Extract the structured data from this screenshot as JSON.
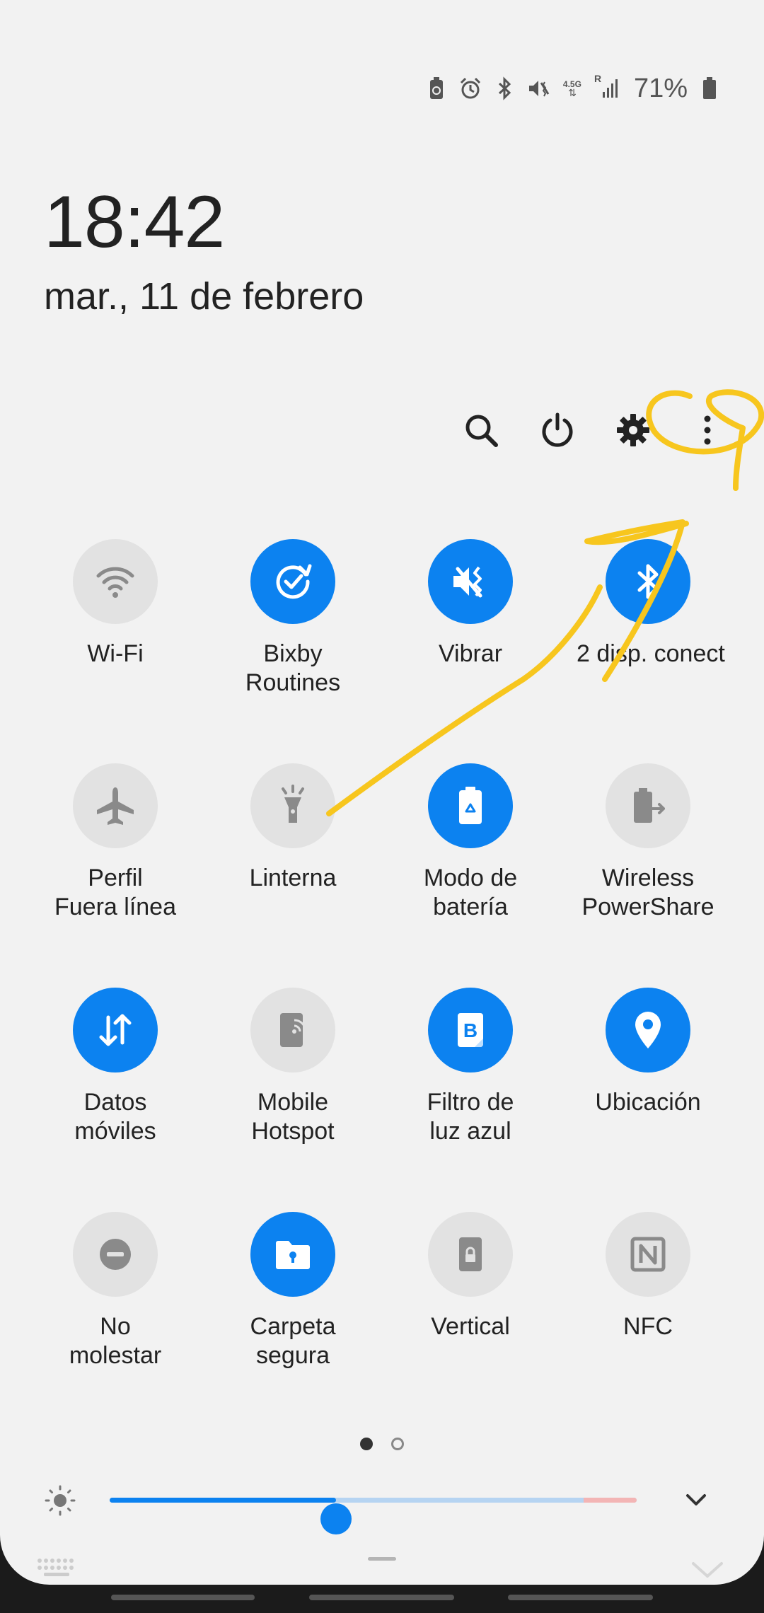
{
  "status_bar": {
    "battery_percent": "71%",
    "icons": [
      "battery-saver-icon",
      "alarm-icon",
      "bluetooth-icon",
      "vibrate-icon",
      "data-4-5g-icon",
      "signal-roaming-icon",
      "battery-icon"
    ],
    "network_label": "4.5G",
    "roaming_label": "R"
  },
  "clock": {
    "time": "18:42",
    "date": "mar., 11 de febrero"
  },
  "actions": [
    "search-icon",
    "power-icon",
    "gear-icon",
    "more-vert-icon"
  ],
  "tiles": [
    {
      "id": "wifi",
      "label": "Wi-Fi",
      "state": "off",
      "icon": "wifi-icon"
    },
    {
      "id": "bixby",
      "label": "Bixby\nRoutines",
      "state": "on",
      "icon": "bixby-routines-icon"
    },
    {
      "id": "vibrate",
      "label": "Vibrar",
      "state": "on",
      "icon": "vibrate-icon"
    },
    {
      "id": "bluetooth",
      "label": "2 disp. conect",
      "state": "on",
      "icon": "bluetooth-icon"
    },
    {
      "id": "airplane",
      "label": "Perfil\nFuera línea",
      "state": "off",
      "icon": "airplane-icon"
    },
    {
      "id": "flashlight",
      "label": "Linterna",
      "state": "off",
      "icon": "flashlight-icon"
    },
    {
      "id": "battery-mode",
      "label": "Modo de\nbatería",
      "state": "on",
      "icon": "battery-mode-icon"
    },
    {
      "id": "powershare",
      "label": "Wireless\nPowerShare",
      "state": "off",
      "icon": "powershare-icon"
    },
    {
      "id": "mobile-data",
      "label": "Datos\nmóviles",
      "state": "on",
      "icon": "mobile-data-icon"
    },
    {
      "id": "hotspot",
      "label": "Mobile\nHotspot",
      "state": "off",
      "icon": "hotspot-icon"
    },
    {
      "id": "blue-light",
      "label": "Filtro de\nluz azul",
      "state": "on",
      "icon": "blue-light-filter-icon"
    },
    {
      "id": "location",
      "label": "Ubicación",
      "state": "on",
      "icon": "location-icon"
    },
    {
      "id": "dnd",
      "label": "No\nmolestar",
      "state": "off",
      "icon": "do-not-disturb-icon"
    },
    {
      "id": "secure-folder",
      "label": "Carpeta\nsegura",
      "state": "on",
      "icon": "secure-folder-icon"
    },
    {
      "id": "portrait",
      "label": "Vertical",
      "state": "off",
      "icon": "portrait-lock-icon"
    },
    {
      "id": "nfc",
      "label": "NFC",
      "state": "off",
      "icon": "nfc-icon"
    }
  ],
  "pager": {
    "pages": 2,
    "current": 1
  },
  "brightness": {
    "level": 0.43,
    "icon": "brightness-icon",
    "expand_icon": "chevron-down-icon"
  },
  "colors": {
    "accent": "#0c82f0",
    "panel_bg": "#f2f2f2",
    "tile_off": "#e2e2e2",
    "annotation": "#f7c61e"
  }
}
